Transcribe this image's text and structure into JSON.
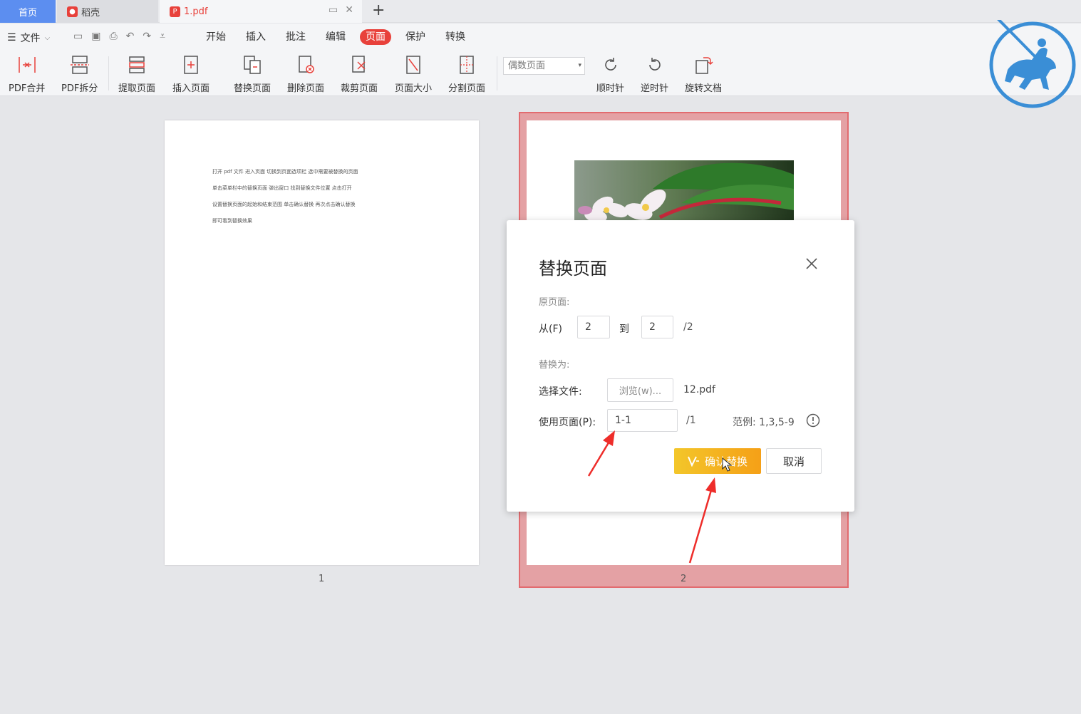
{
  "tabs": {
    "home": "首页",
    "docer": "稻壳",
    "pdf": "1.pdf",
    "add": "+"
  },
  "menu": {
    "file": "文件",
    "tabs": [
      "开始",
      "插入",
      "批注",
      "编辑",
      "页面",
      "保护",
      "转换"
    ],
    "active_tab": "页面"
  },
  "toolbar": {
    "merge": "PDF合并",
    "split": "PDF拆分",
    "extract": "提取页面",
    "insert": "插入页面",
    "replace": "替换页面",
    "delete": "删除页面",
    "crop": "裁剪页面",
    "page_size": "页面大小",
    "divide": "分割页面",
    "page_select": "偶数页面",
    "clockwise": "顺时针",
    "counterclockwise": "逆时针",
    "rotate_doc": "旋转文档"
  },
  "page1": {
    "lines": [
      "打开 pdf 文件   进入页面   切换到页面选项栏   选中需要被替换的页面",
      "单击菜单栏中的替换页面   弹出窗口   找到替换文件位置   点击打开",
      "设置替换页面的起始和结束范围   单击确认替换   再次点击确认替换",
      "即可看到替换效果"
    ],
    "number": "1"
  },
  "page2": {
    "number": "2"
  },
  "dialog": {
    "title": "替换页面",
    "original_section": "原页面:",
    "from_label": "从(F)",
    "from_value": "2",
    "to_label": "到",
    "to_value": "2",
    "total": "/2",
    "replace_section": "替换为:",
    "choose_file_label": "选择文件:",
    "browse_label": "浏览(w)...",
    "file_name": "12.pdf",
    "use_pages_label": "使用页面(P):",
    "use_pages_value": "1-1",
    "use_pages_total": "/1",
    "example": "范例:  1,3,5-9",
    "confirm_label": "确认替换",
    "cancel_label": "取消"
  },
  "colors": {
    "accent_red": "#e8413b",
    "home_tab_blue": "#5c8ef0",
    "confirm_yellow": "#f5b01f",
    "selection_pink": "#e4a1a4"
  }
}
